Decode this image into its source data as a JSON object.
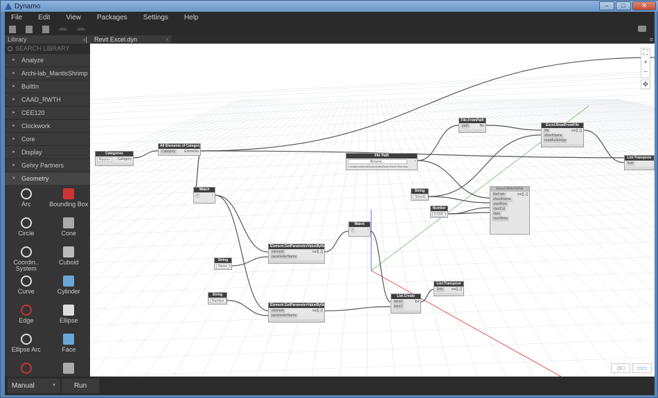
{
  "window": {
    "title": "Dynamo"
  },
  "menu": [
    "File",
    "Edit",
    "View",
    "Packages",
    "Settings",
    "Help"
  ],
  "library": {
    "title": "Library",
    "search_placeholder": "SEARCH LIBRARY",
    "categories": [
      "Analyze",
      "Archi-lab_MantisShrimp",
      "BuiltIn",
      "CAAD_RWTH",
      "CEE120",
      "Clockwork",
      "Core",
      "Display",
      "Gehry Partners",
      "Geometry"
    ],
    "geometry_items": [
      "Arc",
      "Bounding Box",
      "Circle",
      "Cone",
      "Coordin.. System",
      "Cuboid",
      "Curve",
      "Cylinder",
      "Edge",
      "Ellipse",
      "Ellipse Arc",
      "Face",
      "",
      ""
    ]
  },
  "tab": {
    "label": "Revit Excel.dyn",
    "close": "×"
  },
  "canvas_controls": {
    "zoom_fit": "⛶",
    "zoom_in": "+",
    "zoom_out": "−",
    "pan": "✥"
  },
  "nodes": {
    "categories": {
      "title": "Categories",
      "value": "Rooms",
      "out": "Category"
    },
    "all_elements": {
      "title": "All Elements of Category",
      "in": "Category",
      "out": "Elements"
    },
    "watch1": {
      "title": "Watch"
    },
    "string1": {
      "title": "String",
      "value": "Name"
    },
    "string2": {
      "title": "String",
      "value": "Number"
    },
    "getparam1": {
      "title": "Element.GetParameterValueByName",
      "in1": "element",
      "in2": "parameterName",
      "out": "var[]..[]"
    },
    "getparam2": {
      "title": "Element.GetParameterValueByName",
      "in1": "element",
      "in2": "parameterName",
      "out": "var[]..[]"
    },
    "watch2": {
      "title": "Watch"
    },
    "list_create": {
      "title": "List.Create",
      "in1": "item0",
      "in2": "item1",
      "out": "list"
    },
    "list_transpose": {
      "title": "List.Transpose",
      "in": "lists",
      "out": "var[]..[]"
    },
    "file_path": {
      "title": "File Path",
      "button": "Browse...",
      "path": "C:\\Users\\mhiruf\\Documents\\Revit Excel Test.xlsx"
    },
    "file_from_path": {
      "title": "File.FromPath",
      "in": "path",
      "out": "file"
    },
    "excel_read": {
      "title": "Excel.ReadFromFile",
      "in1": "file",
      "in2": "sheetName",
      "in3": "readAsStrings",
      "out": "var[]..[]"
    },
    "string3": {
      "title": "String",
      "value": "Sheet1"
    },
    "number1": {
      "title": "Number",
      "value": "0.000"
    },
    "excel_write": {
      "title": "Excel.WriteToFile",
      "in1": "filePath",
      "in2": "sheetName",
      "in3": "startRow",
      "in4": "startCol",
      "in5": "data",
      "in6": "overWrite",
      "out": "var[]..[]"
    },
    "list_transpose2": {
      "title": "List.Transpose",
      "in": "lists"
    }
  },
  "bottom": {
    "run_mode": "Manual",
    "run_label": "Run"
  }
}
